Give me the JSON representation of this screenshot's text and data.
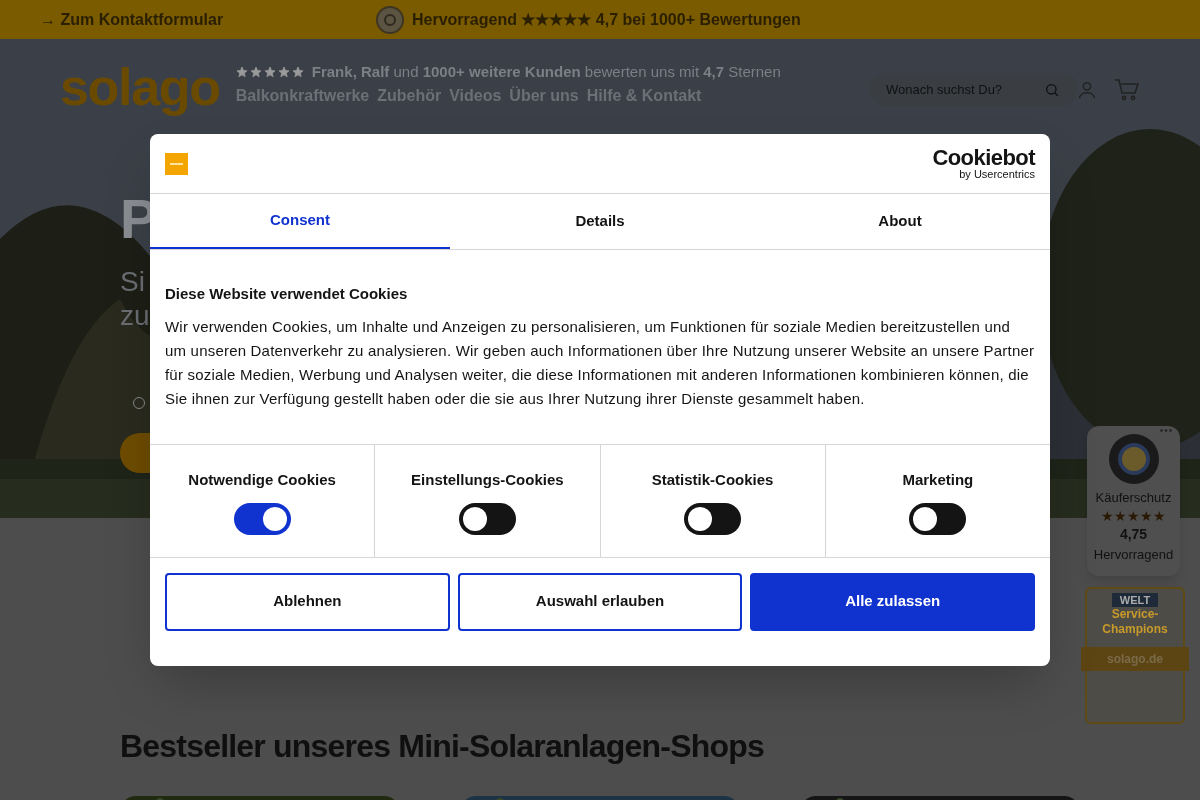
{
  "announcement": {
    "contact_link": "→ Zum Kontaktformular",
    "rating_text": "Hervorragend ★★★★★ 4,7 bei 1000+ Bewertungen"
  },
  "header": {
    "logo": "solago",
    "stars": 5,
    "review_text": "**Frank, Ralf** und **1000+ weitere Kunden** bewerten uns mit **4,7** Sternen",
    "nav": [
      "Balkonkraftwerke",
      "Zubehör",
      "Videos",
      "Über uns",
      "Hilfe & Kontakt"
    ],
    "search": {
      "placeholder": "Wonach suchst Du?"
    }
  },
  "hero": {
    "heading_fragments": [
      "P"
    ],
    "sub_fragments": [
      "Si",
      "zu"
    ]
  },
  "section": {
    "title": "Bestseller unseres Mini-Solaranlagen-Shops"
  },
  "trust_badge": {
    "label": "Käuferschutz",
    "stars": 5,
    "score": "4,75",
    "rating": "Hervorragend"
  },
  "award_badge": {
    "brand": "WELT",
    "title": "Service-Champions",
    "site": "solago.de"
  },
  "cookie_dialog": {
    "vendor": "Cookiebot",
    "vendor_sub": "by Usercentrics",
    "tabs": [
      {
        "label": "Consent",
        "selected": true
      },
      {
        "label": "Details",
        "selected": false
      },
      {
        "label": "About",
        "selected": false
      }
    ],
    "heading": "Diese Website verwendet Cookies",
    "body": "Wir verwenden Cookies, um Inhalte und Anzeigen zu personalisieren, um Funktionen für soziale Medien bereitzustellen und um unseren Datenverkehr zu analysieren. Wir geben auch Informationen über Ihre Nutzung unserer Website an unsere Partner für soziale Medien, Werbung und Analysen weiter, die diese Informationen mit anderen Informationen kombinieren können, die Sie ihnen zur Verfügung gestellt haben oder die sie aus Ihrer Nutzung ihrer Dienste gesammelt haben.",
    "categories": [
      {
        "label": "Notwendige Cookies",
        "on": true
      },
      {
        "label": "Einstellungs-Cookies",
        "on": false
      },
      {
        "label": "Statistik-Cookies",
        "on": false
      },
      {
        "label": "Marketing",
        "on": false
      }
    ],
    "buttons": [
      {
        "label": "Ablehnen",
        "kind": "outline"
      },
      {
        "label": "Auswahl erlauben",
        "kind": "outline"
      },
      {
        "label": "Alle zulassen",
        "kind": "primary"
      }
    ]
  }
}
